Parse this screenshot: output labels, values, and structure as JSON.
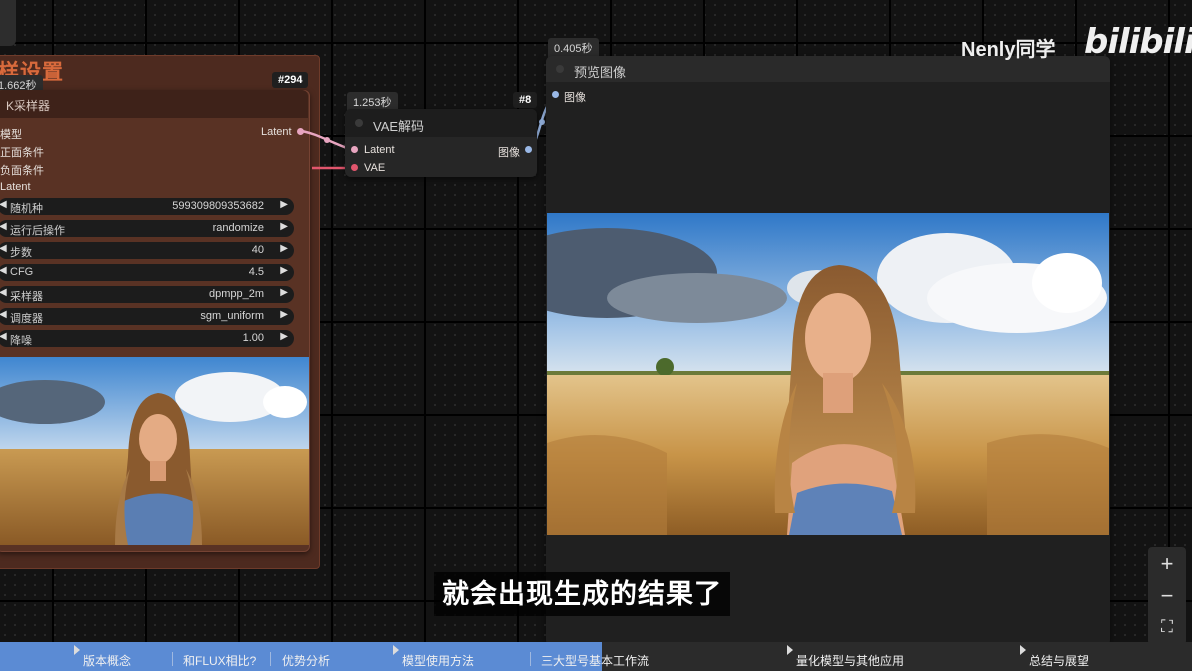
{
  "group": {
    "title": "样设置",
    "time": "1.662秒"
  },
  "ksampler": {
    "id": "#294",
    "title": "K采样器",
    "inputs": [
      "模型",
      "正面条件",
      "负面条件",
      "Latent"
    ],
    "output": "Latent",
    "widgets": [
      {
        "label": "随机种",
        "value": "599309809353682"
      },
      {
        "label": "运行后操作",
        "value": "randomize"
      },
      {
        "label": "步数",
        "value": "40"
      },
      {
        "label": "CFG",
        "value": "4.5"
      },
      {
        "label": "采样器",
        "value": "dpmpp_2m"
      },
      {
        "label": "调度器",
        "value": "sgm_uniform"
      },
      {
        "label": "降噪",
        "value": "1.00"
      }
    ]
  },
  "vae": {
    "time": "1.253秒",
    "id": "#8",
    "title": "VAE解码",
    "inputs": [
      "Latent",
      "VAE"
    ],
    "output": "图像"
  },
  "preview": {
    "time": "0.405秒",
    "title": "预览图像",
    "input": "图像"
  },
  "watermark": {
    "channel": "Nenly同学",
    "logo": "bilibili"
  },
  "subtitle": "就会出现生成的结果了",
  "zoom": {
    "in": "+",
    "out": "−",
    "fit": "⛶"
  },
  "chapters": {
    "progress_percent": 50.5,
    "items": [
      "版本概念",
      "和FLUX相比?",
      "优势分析",
      "模型使用方法",
      "三大型号基本工作流",
      "量化模型与其他应用",
      "总结与展望"
    ]
  },
  "colors": {
    "group_bg": "#4d2a1f",
    "group_title": "#d86a3c",
    "progress": "#5b8bd4",
    "link_pink": "#e8a5c0",
    "link_red": "#e2566d"
  }
}
